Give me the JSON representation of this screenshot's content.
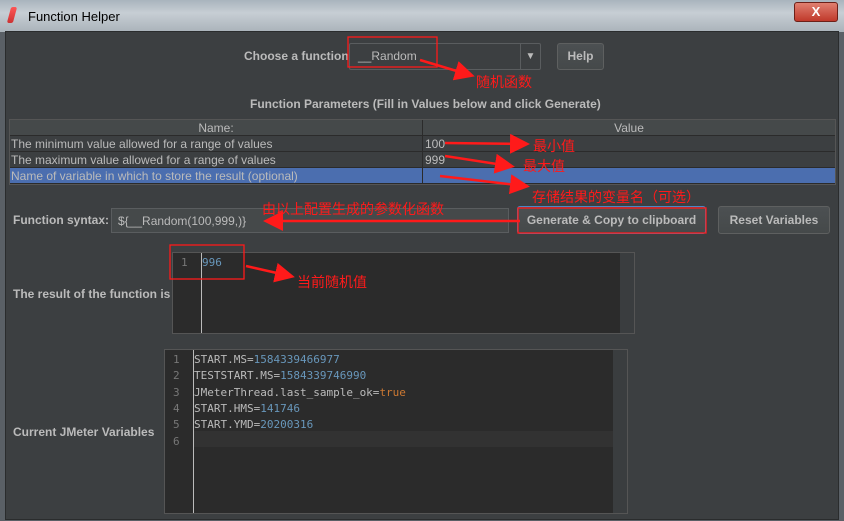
{
  "window": {
    "title": "Function Helper",
    "close_label": "X"
  },
  "chooser": {
    "label": "Choose a function",
    "selected": "__Random",
    "help_label": "Help"
  },
  "params": {
    "heading": "Function Parameters (Fill in Values below and click Generate)",
    "columns": [
      "Name:",
      "Value"
    ],
    "rows": [
      {
        "name": "The minimum value allowed for a range of values",
        "value": "100"
      },
      {
        "name": "The maximum value allowed for a range of values",
        "value": "999"
      },
      {
        "name": "Name of variable in which to store the result (optional)",
        "value": ""
      }
    ]
  },
  "syntax": {
    "label": "Function syntax:",
    "value": "${__Random(100,999,)}",
    "generate_label": "Generate & Copy to clipboard",
    "reset_label": "Reset Variables"
  },
  "result": {
    "label": "The result of the function is",
    "lines": [
      "996"
    ]
  },
  "variables": {
    "label": "Current JMeter Variables",
    "lines": [
      {
        "key": "START.MS=",
        "val": "1584339466977",
        "type": "num"
      },
      {
        "key": "TESTSTART.MS=",
        "val": "1584339746990",
        "type": "num"
      },
      {
        "key": "JMeterThread.last_sample_ok=",
        "val": "true",
        "type": "kw"
      },
      {
        "key": "START.HMS=",
        "val": "141746",
        "type": "num"
      },
      {
        "key": "START.YMD=",
        "val": "20200316",
        "type": "num"
      },
      {
        "key": "",
        "val": "",
        "type": "num"
      }
    ]
  },
  "annotations": {
    "random_fn": "随机函数",
    "min": "最小值",
    "max": "最大值",
    "varname": "存储结果的变量名（可选）",
    "syntax": "由以上配置生成的参数化函数",
    "current": "当前随机值",
    "color": "#ff1a1a"
  }
}
